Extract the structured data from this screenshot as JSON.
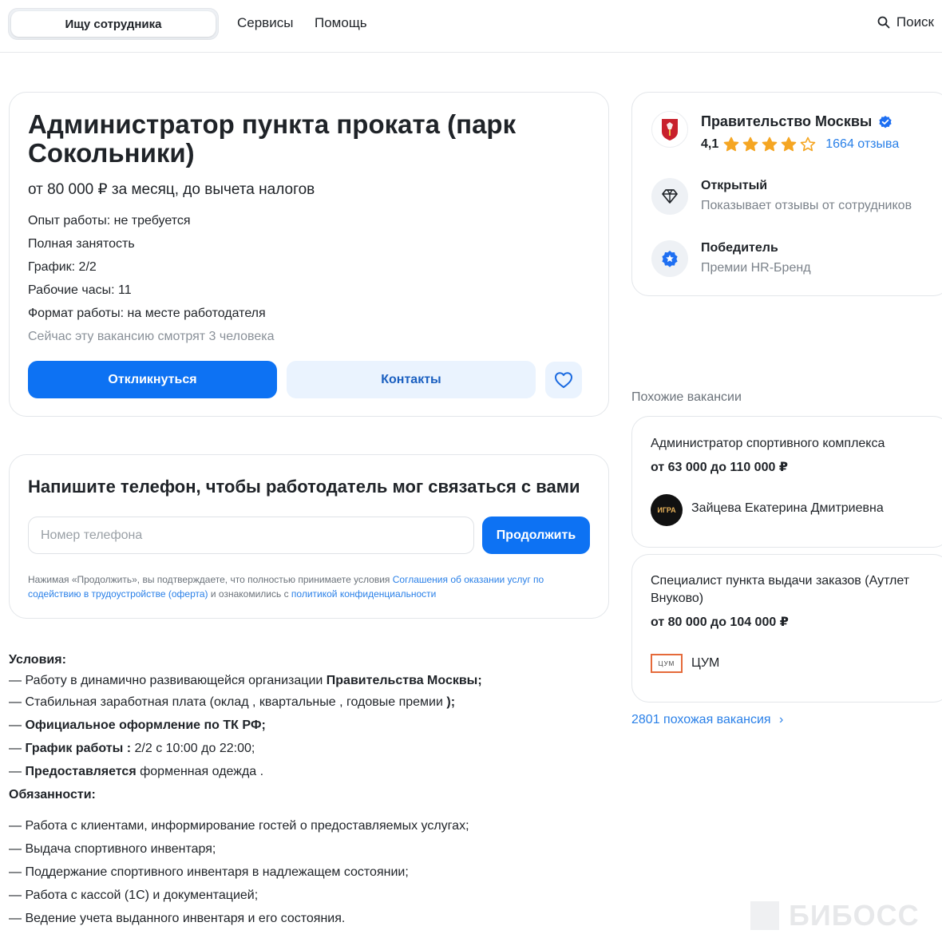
{
  "header": {
    "seg_label": "Ищу сотрудника",
    "nav": [
      "Сервисы",
      "Помощь"
    ],
    "search_label": "Поиск"
  },
  "vacancy": {
    "title": "Администратор пункта проката (парк Сокольники)",
    "salary": "от 80 000 ₽ за месяц, до вычета налогов",
    "facts": [
      "Опыт работы: не требуется",
      "Полная занятость",
      "График: 2/2",
      "Рабочие часы: 11",
      "Формат работы: на месте работодателя"
    ],
    "viewers": "Сейчас эту вакансию смотрят 3 человека",
    "apply_label": "Откликнуться",
    "contacts_label": "Контакты"
  },
  "phone_form": {
    "title": "Напишите телефон, чтобы работодатель мог связаться с вами",
    "placeholder": "Номер телефона",
    "continue_label": "Продолжить",
    "legal_prefix": "Нажимая «Продолжить», вы подтверждаете, что полностью принимаете условия ",
    "legal_link1": "Соглашения об оказании услуг по содействию в трудоустройстве (оферта)",
    "legal_middle": " и ознакомились с ",
    "legal_link2": "политикой конфиденциальности"
  },
  "description": {
    "conditions_title": "Условия:",
    "conditions": [
      {
        "plain": "— Работу в динамично развивающейся организации ",
        "bold": "Правительства Москвы;",
        "tail": ""
      },
      {
        "plain": "— Стабильная заработная плата (оклад , квартальные , годовые премии ",
        "bold": ");",
        "tail": ""
      },
      {
        "plain": "— ",
        "bold": "Официальное оформление по ТК РФ;",
        "tail": ""
      },
      {
        "plain": "— ",
        "bold": "График работы :",
        "tail": " 2/2 с 10:00 до 22:00;"
      },
      {
        "plain": "— ",
        "bold": "Предоставляется",
        "tail": " форменная одежда ."
      }
    ],
    "duties_title": "Обязанности:",
    "duties": [
      "— Работа с клиентами, информирование гостей о предоставляемых услугах;",
      "— Выдача спортивного инвентаря;",
      "— Поддержание спортивного инвентаря в надлежащем состоянии;",
      "— Работа с кассой (1С) и документацией;",
      "— Ведение учета выданного инвентаря и его состояния."
    ]
  },
  "employer": {
    "name": "Правительство Москвы",
    "rating": "4,1",
    "rating_value": 4.1,
    "reviews": "1664 отзыва",
    "badges": [
      {
        "title": "Открытый",
        "subtitle": "Показывает отзывы от сотрудников",
        "icon": "diamond-icon"
      },
      {
        "title": "Победитель",
        "subtitle": "Премии HR-Бренд",
        "icon": "star-award-icon"
      }
    ]
  },
  "similar": {
    "title": "Похожие вакансии",
    "items": [
      {
        "title": "Администратор спортивного комплекса",
        "salary": "от 63 000 до 110 000 ₽",
        "company": "Зайцева Екатерина Дмитриевна",
        "logo_text": "ИГРА"
      },
      {
        "title": "Специалист пункта выдачи заказов (Аутлет Внуково)",
        "salary": "от 80 000 до 104 000 ₽",
        "company": "ЦУМ",
        "logo_text": "ЦУМ"
      }
    ],
    "more_label": "2801 похожая вакансия"
  },
  "watermark": "БИБОСС",
  "colors": {
    "accent": "#0d72f3",
    "accent_light": "#eaf3fe",
    "link": "#2a80e8",
    "star": "#f5a623",
    "verified": "#1e6ff2"
  }
}
